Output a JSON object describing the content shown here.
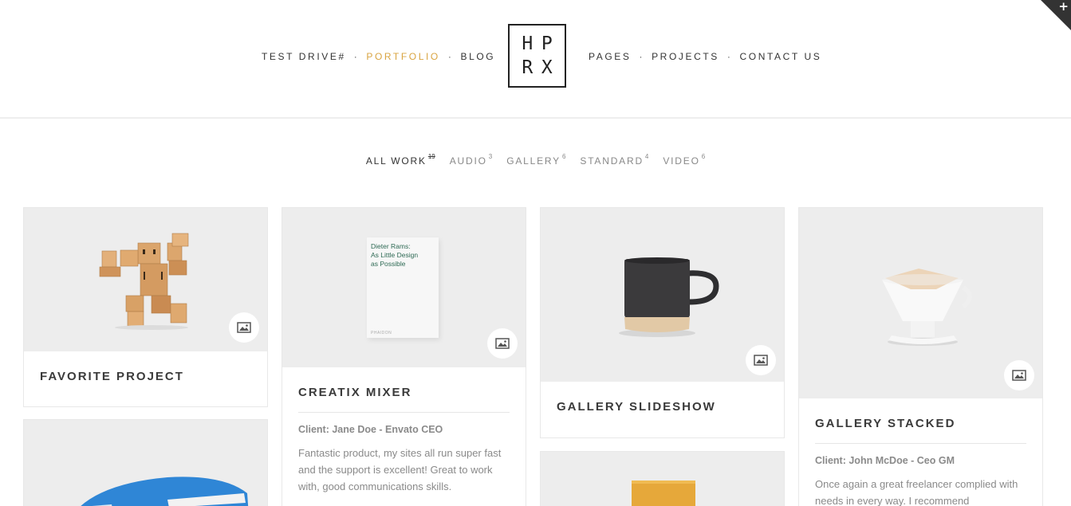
{
  "nav": {
    "left": [
      "TEST DRIVE#",
      "PORTFOLIO",
      "BLOG"
    ],
    "right": [
      "PAGES",
      "PROJECTS",
      "CONTACT US"
    ],
    "separator": "·",
    "active": "PORTFOLIO",
    "accent_color": "#d9a441"
  },
  "logo": {
    "letters": [
      "H",
      "P",
      "R",
      "X"
    ]
  },
  "corner": {
    "icon": "plus-icon",
    "glyph": "+"
  },
  "filters": [
    {
      "label": "ALL WORK",
      "count": "19"
    },
    {
      "label": "AUDIO",
      "count": "3"
    },
    {
      "label": "GALLERY",
      "count": "6"
    },
    {
      "label": "STANDARD",
      "count": "4"
    },
    {
      "label": "VIDEO",
      "count": "6"
    }
  ],
  "cards": [
    {
      "title": "FAVORITE PROJECT",
      "badge_icon": "image-icon"
    },
    {
      "title": "CREATIX MIXER",
      "client": "Client: Jane Doe - Envato CEO",
      "desc": "Fantastic product, my sites all run super fast and the support is excellent! Great to work with, good communications skills.",
      "book": {
        "line1": "Dieter Rams:",
        "line2": "As Little Design",
        "line3": "as Possible",
        "publisher": "PHAIDON"
      },
      "badge_icon": "image-icon"
    },
    {
      "title": "GALLERY SLIDESHOW",
      "badge_icon": "image-icon"
    },
    {
      "title": "GALLERY STACKED",
      "client": "Client: John McDoe - Ceo GM",
      "desc": "Once again a great freelancer complied with needs in every way. I recommend",
      "badge_icon": "image-icon"
    }
  ]
}
